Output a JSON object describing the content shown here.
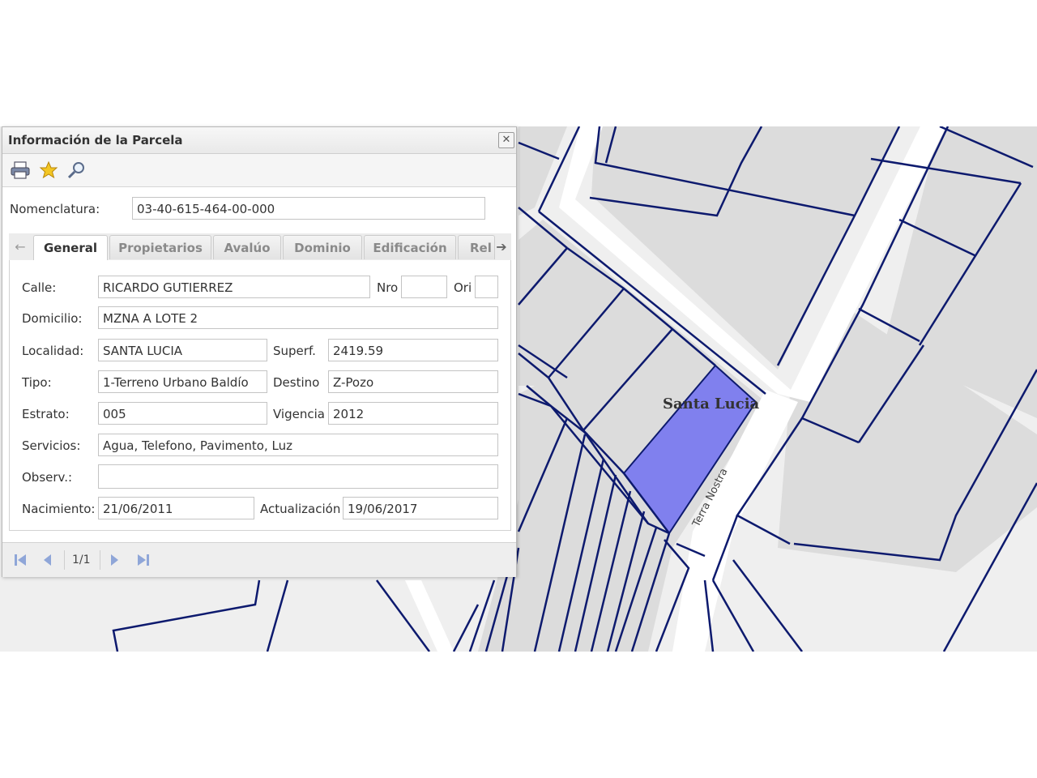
{
  "window": {
    "title": "Información de la Parcela",
    "close_symbol": "✕"
  },
  "toolbar": {
    "print_icon": "print-icon",
    "favorite_icon": "star-icon",
    "zoom_icon": "magnifier-icon"
  },
  "nomenclatura": {
    "label": "Nomenclatura:",
    "value": "03-40-615-464-00-000"
  },
  "tabs": [
    {
      "label": "General",
      "active": true
    },
    {
      "label": "Propietarios",
      "active": false
    },
    {
      "label": "Avalúo",
      "active": false
    },
    {
      "label": "Dominio",
      "active": false
    },
    {
      "label": "Edificación",
      "active": false
    },
    {
      "label": "Rel",
      "active": false
    }
  ],
  "tab_nav": {
    "left_arrow": "←",
    "right_arrow": "➔"
  },
  "form": {
    "calle": {
      "label": "Calle:",
      "value": "RICARDO GUTIERREZ"
    },
    "nro": {
      "label": "Nro",
      "value": ""
    },
    "ori": {
      "label": "Ori",
      "value": ""
    },
    "domicilio": {
      "label": "Domicilio:",
      "value": "MZNA A LOTE 2"
    },
    "localidad": {
      "label": "Localidad:",
      "value": "SANTA LUCIA"
    },
    "superf": {
      "label": "Superf.",
      "value": "2419.59"
    },
    "tipo": {
      "label": "Tipo:",
      "value": "1-Terreno Urbano Baldío"
    },
    "destino": {
      "label": "Destino",
      "value": "Z-Pozo"
    },
    "estrato": {
      "label": "Estrato:",
      "value": "005"
    },
    "vigencia": {
      "label": "Vigencia",
      "value": "2012"
    },
    "servicios": {
      "label": "Servicios:",
      "value": "Agua, Telefono, Pavimento, Luz"
    },
    "observ": {
      "label": "Observ.:",
      "value": ""
    },
    "nacimiento": {
      "label": "Nacimiento:",
      "value": "21/06/2011"
    },
    "actualizacion": {
      "label": "Actualización",
      "value": "19/06/2017"
    }
  },
  "pager": {
    "info": "1/1"
  },
  "map": {
    "locality_label": "Santa Lucia",
    "street_label": "Terra Nostra",
    "parcel_line_color": "#0d1a6e",
    "highlight_color": "#8080ee",
    "block_color": "#dcdcdc",
    "street_color": "#ffffff"
  }
}
